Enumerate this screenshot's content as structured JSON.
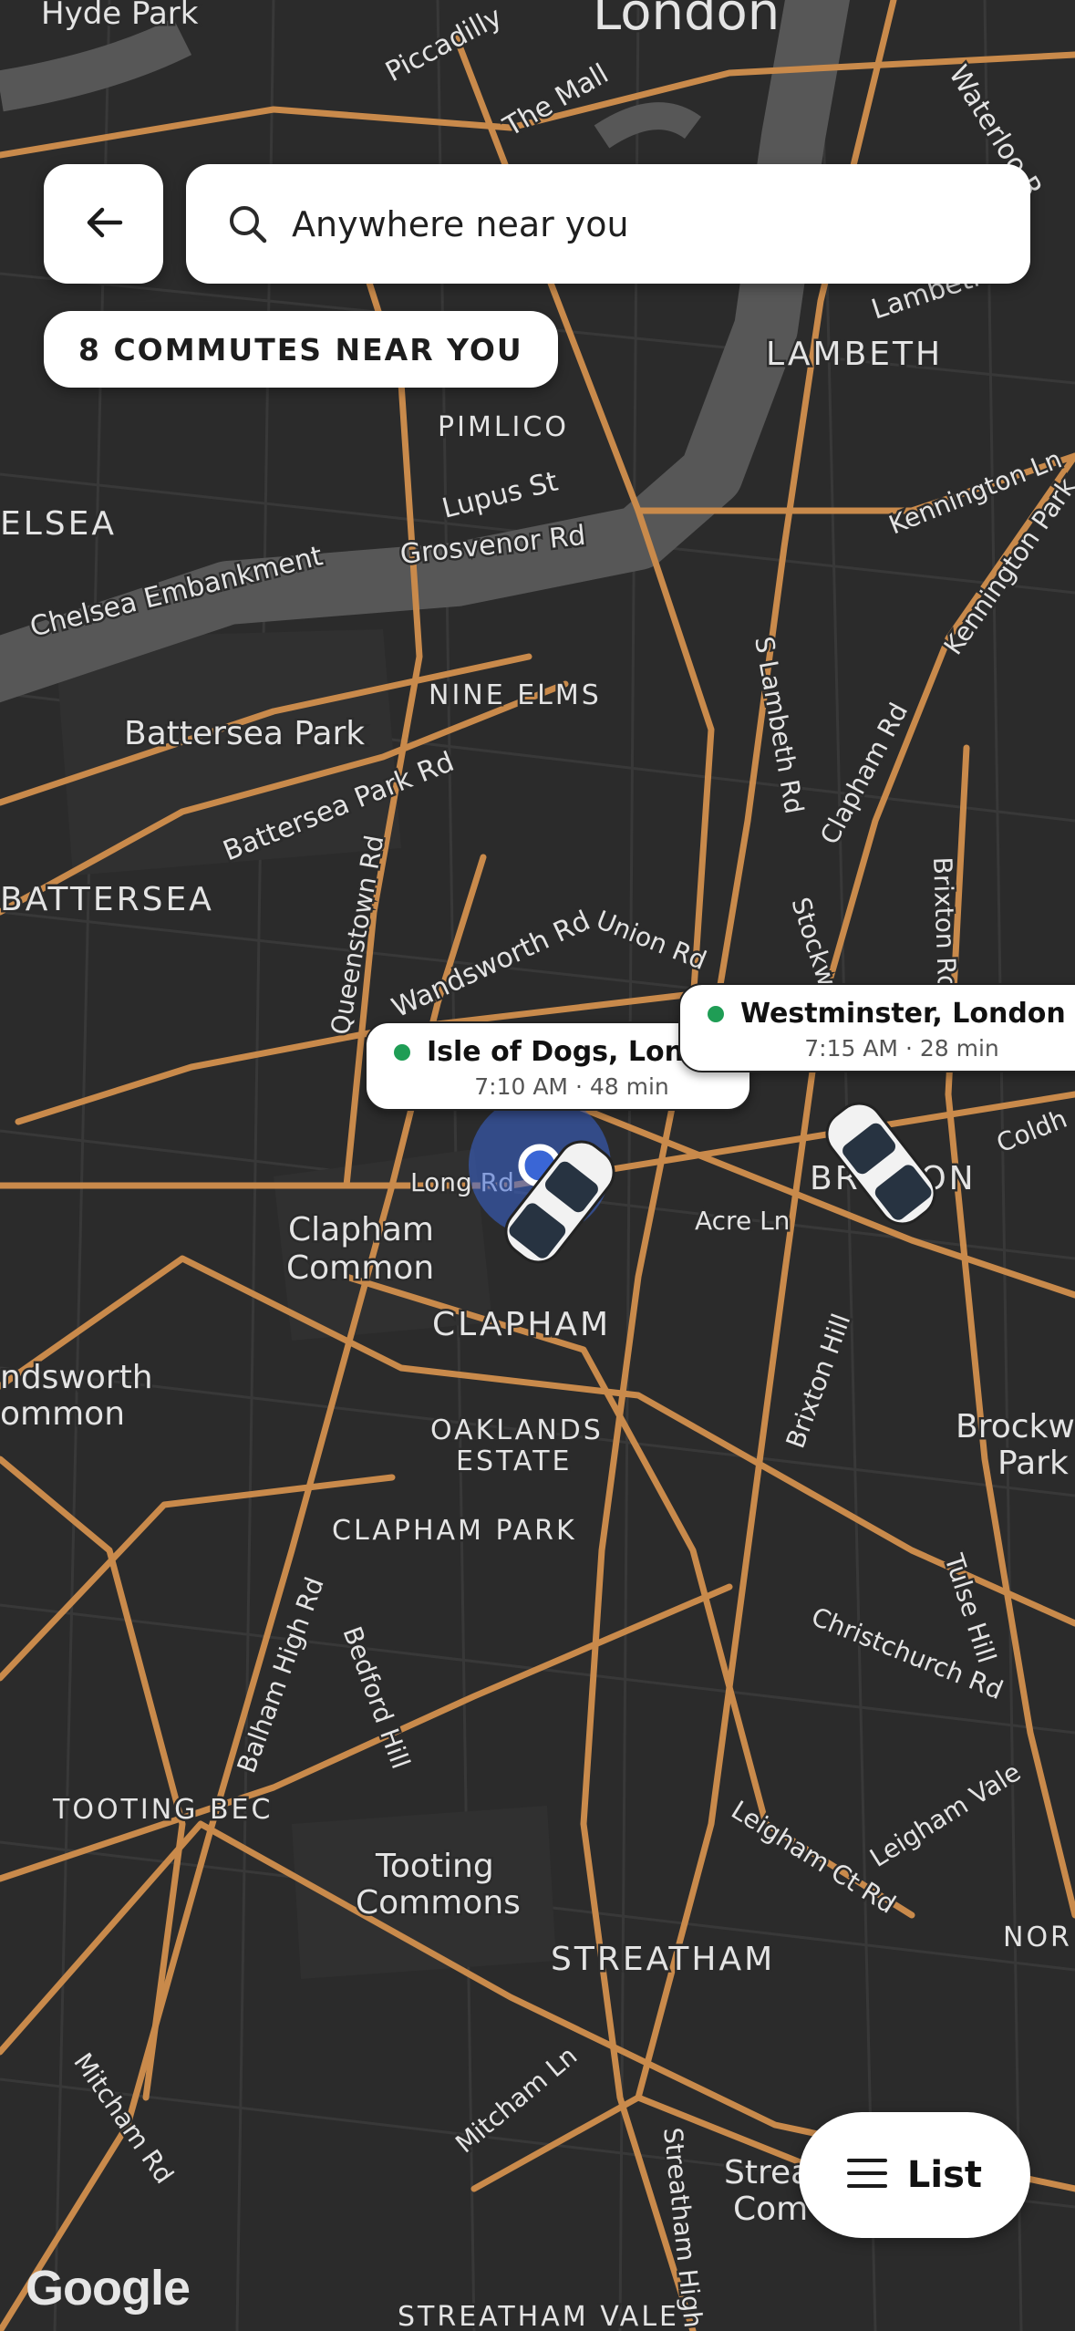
{
  "search": {
    "placeholder": "Anywhere near you"
  },
  "commutes_chip": "8 COMMUTES NEAR YOU",
  "pins": [
    {
      "title": "Isle of Dogs, London",
      "time": "7:10 AM",
      "duration": "48 min",
      "time_text": "7:10 AM · 48 min"
    },
    {
      "title": "Westminster, London",
      "time": "7:15 AM",
      "duration": "28 min",
      "time_text": "7:15 AM · 28 min"
    }
  ],
  "list_button": "List",
  "attribution": "Google",
  "map_labels": {
    "hyde_park": "Hyde Park",
    "london": "London",
    "piccadilly": "Piccadilly",
    "the_mall": "The Mall",
    "waterloo": "Waterloo R",
    "lambeth_upper": "Lambeth",
    "lambeth": "LAMBETH",
    "pimlico": "PIMLICO",
    "lupus_st": "Lupus St",
    "chelsea": "ELSEA",
    "grosvenor_rd": "Grosvenor Rd",
    "chelsea_emb": "Chelsea Embankment",
    "kennington_ln": "Kennington Ln",
    "kennington_park": "Kennington Park",
    "nine_elms": "NINE ELMS",
    "s_lambeth_rd": "S Lambeth Rd",
    "battersea_park": "Battersea Park",
    "battersea_park_rd": "Battersea Park Rd",
    "clapham_rd": "Clapham Rd",
    "battersea": "BATTERSEA",
    "queenstown_rd": "Queenstown Rd",
    "wandsworth_rd": "Wandsworth Rd",
    "union_rd": "Union Rd",
    "stockwell": "Stockw",
    "brixton_rd": "Brixton Rd",
    "coldharbour": "Coldh",
    "long_rd": "Long Rd",
    "acre_ln": "Acre Ln",
    "brixton": "BRIXTON",
    "clapham_common": "Clapham Common",
    "clapham": "CLAPHAM",
    "wandsworth_common": "ndsworth ommon",
    "oaklands_estate": "OAKLANDS ESTATE",
    "brixton_hill": "Brixton Hill",
    "brockwell_park": "Brockw Park",
    "clapham_park": "CLAPHAM PARK",
    "tulse_hill": "Tulse Hill",
    "balham_high_rd": "Balham High Rd",
    "bedford_hill": "Bedford Hill",
    "christchurch_rd": "Christchurch Rd",
    "tooting_bec": "TOOTING BEC",
    "tooting_commons": "Tooting Commons",
    "leigham_vale": "Leigham Vale",
    "leigham_ct_rd": "Leigham Ct Rd",
    "streatham": "STREATHAM",
    "norwood": "NOR",
    "mitcham_rd": "Mitcham Rd",
    "mitcham_ln": "Mitcham Ln",
    "streatham_high_rd": "Streatham High Rd",
    "streatham_common": "Strea Com",
    "streatham_vale": "STREATHAM VALE"
  },
  "colors": {
    "map_bg": "#2b2b2b",
    "road": "#c98a4b",
    "river": "#5b5b5b",
    "user_dot": "#3a66d6",
    "status_dot": "#1f9d55"
  },
  "icons": {
    "back": "arrow-left-icon",
    "search": "search-icon",
    "list": "list-icon",
    "car": "car-icon",
    "location": "location-dot-icon"
  }
}
